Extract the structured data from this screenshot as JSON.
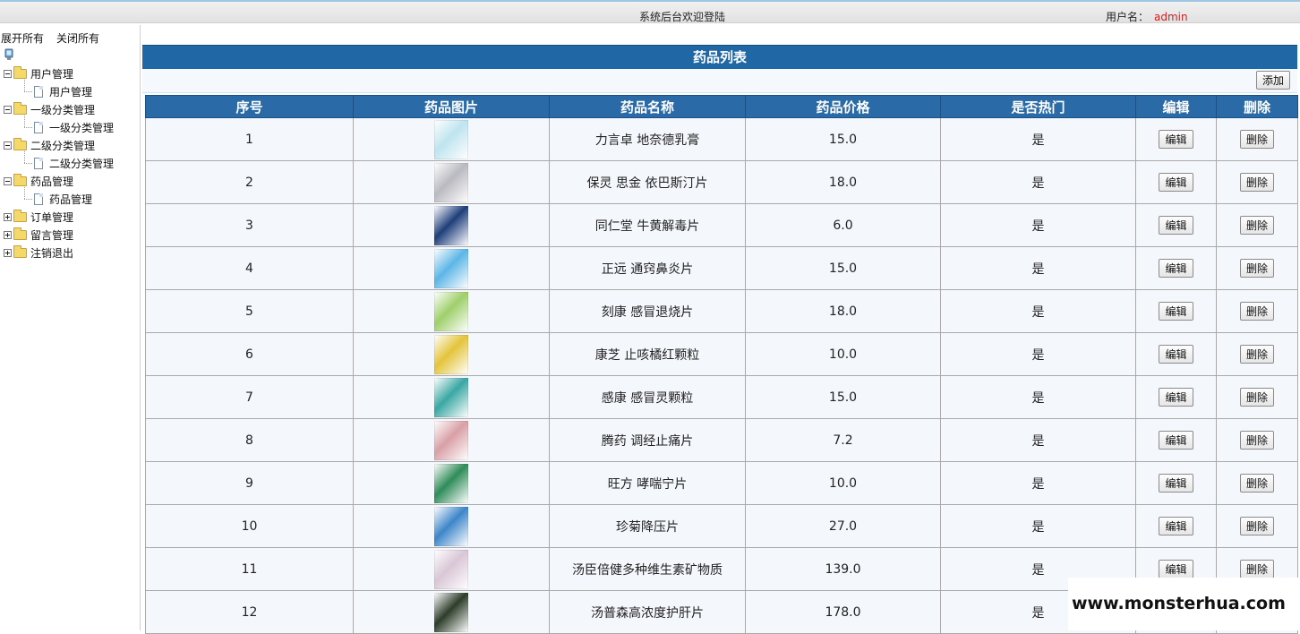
{
  "header": {
    "title": "系统后台欢迎登陆",
    "user_label": "用户名：",
    "username": "admin"
  },
  "sidebar": {
    "expand_all": "展开所有",
    "collapse_all": "关闭所有",
    "groups": [
      {
        "label": "用户管理",
        "expanded": true,
        "children": [
          "用户管理"
        ]
      },
      {
        "label": "一级分类管理",
        "expanded": true,
        "children": [
          "一级分类管理"
        ]
      },
      {
        "label": "二级分类管理",
        "expanded": true,
        "children": [
          "二级分类管理"
        ]
      },
      {
        "label": "药品管理",
        "expanded": true,
        "children": [
          "药品管理"
        ]
      },
      {
        "label": "订单管理",
        "expanded": false,
        "children": []
      },
      {
        "label": "留言管理",
        "expanded": false,
        "children": []
      },
      {
        "label": "注销退出",
        "expanded": false,
        "children": []
      }
    ]
  },
  "main": {
    "title": "药品列表",
    "add_label": "添加",
    "columns": [
      "序号",
      "药品图片",
      "药品名称",
      "药品价格",
      "是否热门",
      "编辑",
      "删除"
    ],
    "edit_label": "编辑",
    "delete_label": "删除",
    "rows": [
      {
        "no": "1",
        "name": "力言卓 地奈德乳膏",
        "price": "15.0",
        "hot": "是",
        "img_color": "#bfe4ef"
      },
      {
        "no": "2",
        "name": "保灵 思金 依巴斯汀片",
        "price": "18.0",
        "hot": "是",
        "img_color": "#b9b9c0"
      },
      {
        "no": "3",
        "name": "同仁堂 牛黄解毒片",
        "price": "6.0",
        "hot": "是",
        "img_color": "#1f3f7a"
      },
      {
        "no": "4",
        "name": "正远 通窍鼻炎片",
        "price": "15.0",
        "hot": "是",
        "img_color": "#5cb6e6"
      },
      {
        "no": "5",
        "name": "刻康 感冒退烧片",
        "price": "18.0",
        "hot": "是",
        "img_color": "#9fcf6a"
      },
      {
        "no": "6",
        "name": "康芝 止咳橘红颗粒",
        "price": "10.0",
        "hot": "是",
        "img_color": "#e3c43a"
      },
      {
        "no": "7",
        "name": "感康 感冒灵颗粒",
        "price": "15.0",
        "hot": "是",
        "img_color": "#3aa7a3"
      },
      {
        "no": "8",
        "name": "腾药 调经止痛片",
        "price": "7.2",
        "hot": "是",
        "img_color": "#d8a0a6"
      },
      {
        "no": "9",
        "name": "旺方 哮喘宁片",
        "price": "10.0",
        "hot": "是",
        "img_color": "#2f8c5a"
      },
      {
        "no": "10",
        "name": "珍菊降压片",
        "price": "27.0",
        "hot": "是",
        "img_color": "#3d86c9"
      },
      {
        "no": "11",
        "name": "汤臣倍健多种维生素矿物质",
        "price": "139.0",
        "hot": "是",
        "img_color": "#d9c6d6"
      },
      {
        "no": "12",
        "name": "汤普森高浓度护肝片",
        "price": "178.0",
        "hot": "是",
        "img_color": "#2d3d2a"
      }
    ]
  },
  "watermark": "www.monsterhua.com"
}
